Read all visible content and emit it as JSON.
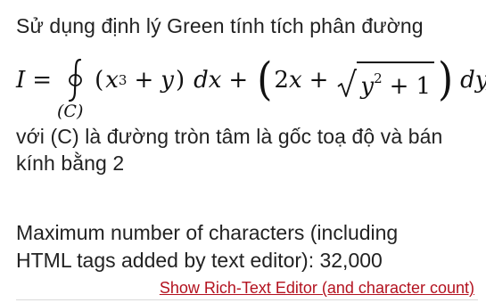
{
  "question": {
    "intro": "Sử dụng định lý Green tính tích phân đường",
    "formula": {
      "lhs": "I",
      "equals": "=",
      "contour_label": "(C)",
      "term1_open": "(",
      "term1_x": "x",
      "term1_exp": "3",
      "term1_plus": "+",
      "term1_y": "y",
      "term1_close": ")",
      "dx": "dx",
      "plus": "+",
      "term2_open": "(",
      "term2_coef": "2",
      "term2_x": "x",
      "term2_plus": "+",
      "sqrt_y": "y",
      "sqrt_exp": "2",
      "sqrt_plus": "+",
      "sqrt_one": "1",
      "term2_close": ")",
      "dy": "dy,"
    },
    "condition_line1": "với (C) là đường tròn tâm là gốc toạ độ và bán",
    "condition_line2": "kính bằng 2"
  },
  "limits": {
    "line1": "Maximum number of characters (including",
    "line2": "HTML tags added by text editor): 32,000"
  },
  "editor_toggle": {
    "label": "Show Rich-Text Editor (and character count)"
  },
  "colors": {
    "text": "#222222",
    "link": "#b3121f",
    "background": "#ffffff"
  }
}
